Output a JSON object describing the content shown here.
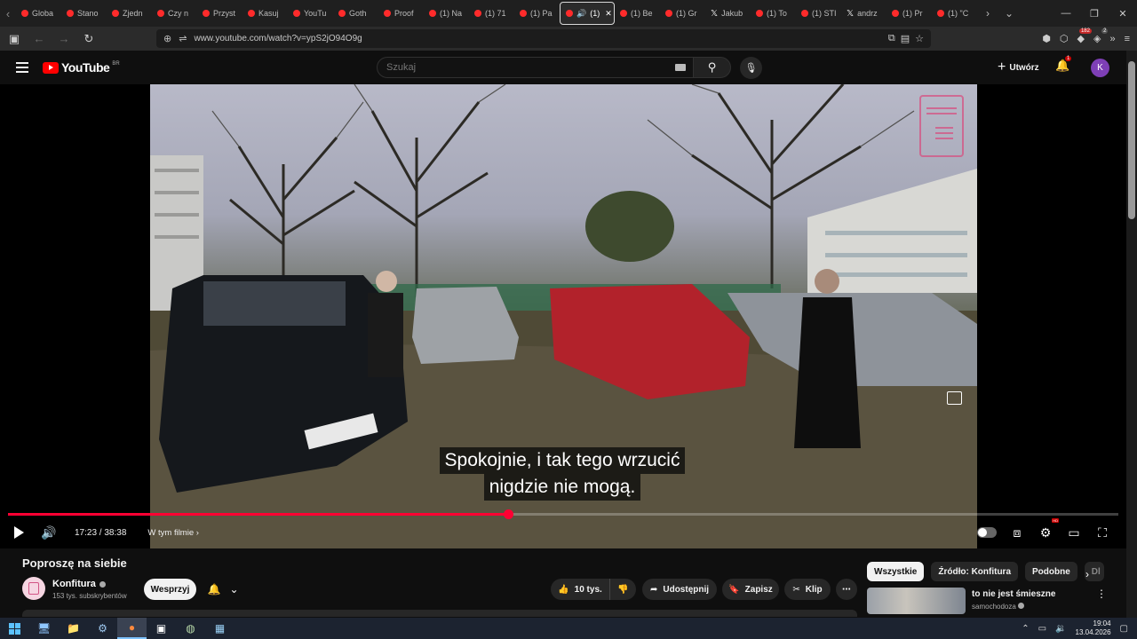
{
  "browser": {
    "tabs": [
      {
        "label": "Globa",
        "icon": "youtube-icon"
      },
      {
        "label": "Stano",
        "icon": "youtube-icon"
      },
      {
        "label": "Zjedn",
        "icon": "youtube-icon"
      },
      {
        "label": "Czy n",
        "icon": "youtube-icon"
      },
      {
        "label": "Przyst",
        "icon": "youtube-icon"
      },
      {
        "label": "Kasuj",
        "icon": "youtube-icon"
      },
      {
        "label": "YouTu",
        "icon": "youtube-icon"
      },
      {
        "label": "Goth",
        "icon": "youtube-icon"
      },
      {
        "label": "Proof",
        "icon": "youtube-icon"
      },
      {
        "label": "(1) Na",
        "icon": "youtube-icon"
      },
      {
        "label": "(1) 71",
        "icon": "youtube-icon"
      },
      {
        "label": "(1) Pa",
        "icon": "youtube-icon"
      },
      {
        "label": "(1)",
        "icon": "youtube-icon",
        "active": true
      },
      {
        "label": "(1) Be",
        "icon": "youtube-icon"
      },
      {
        "label": "(1) Gr",
        "icon": "youtube-icon"
      },
      {
        "label": "Jakub",
        "icon": "x-icon"
      },
      {
        "label": "(1) To",
        "icon": "youtube-icon"
      },
      {
        "label": "(1) STI",
        "icon": "youtube-icon"
      },
      {
        "label": "andrz",
        "icon": "x-icon"
      },
      {
        "label": "(1) Pr",
        "icon": "youtube-icon"
      },
      {
        "label": "(1) \"C",
        "icon": "youtube-icon"
      }
    ],
    "url": "www.youtube.com/watch?v=ypS2jO94O9g",
    "extension_badge": "182",
    "extension_badge2": "2"
  },
  "header": {
    "logo_text": "YouTube",
    "country_code": "BR",
    "search_placeholder": "Szukaj",
    "create_label": "Utwórz",
    "notifications_count": "1",
    "avatar_letter": "K"
  },
  "player": {
    "subtitle_line1": "Spokojnie, i tak tego wrzucić",
    "subtitle_line2": "nigdzie nie mogą.",
    "time": "17:23 / 38:38",
    "chapter_label": "W tym filmie",
    "progress": 0.45,
    "hd_badge": "HD"
  },
  "video_info": {
    "title": "Poproszę na siebie",
    "channel_name": "Konfitura",
    "subscribers": "153 tys. subskrybentów",
    "support_label": "Wesprzyj",
    "likes": "10 tys.",
    "share_label": "Udostępnij",
    "save_label": "Zapisz",
    "clip_label": "Klip"
  },
  "sidebar": {
    "chips": [
      "Wszystkie",
      "Źródło: Konfitura",
      "Podobne",
      "Dl"
    ],
    "recommendation": {
      "title": "to nie jest śmieszne",
      "channel": "samochodoza"
    }
  },
  "taskbar": {
    "time": "19:04",
    "date": "13.04.2026"
  },
  "colors": {
    "accent_red": "#ff0033",
    "background": "#0f0f0f"
  }
}
